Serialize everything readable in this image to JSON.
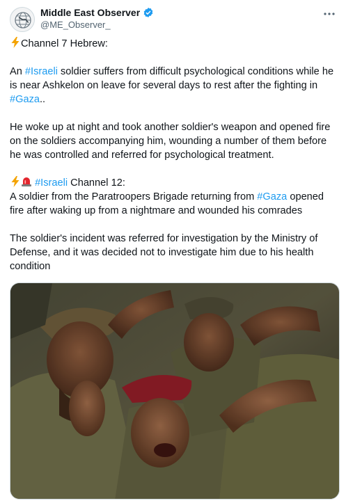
{
  "author": {
    "name": "Middle East Observer",
    "handle": "@ME_Observer_"
  },
  "icons": {
    "avatar": "globe-logo-icon",
    "verified": "verified-badge-icon",
    "more": "more-options-icon",
    "lightning": "high-voltage-emoji",
    "siren": "police-light-emoji"
  },
  "colors": {
    "hashtag": "#1d9bf0",
    "verified": "#1d9bf0",
    "muted": "#536471"
  },
  "tweet": {
    "line1_suffix": "Channel 7 Hebrew:",
    "p2_pre": "An ",
    "tag_israeli": "#Israeli",
    "p2_mid": " soldier suffers from difficult psychological conditions while he is near Ashkelon on leave for several days to rest after the fighting in ",
    "tag_gaza": "#Gaza",
    "p2_end": "..",
    "p3": "He woke up at night and took another soldier's weapon and opened fire on the soldiers accompanying him, wounding a number of them before he was controlled and referred for psychological treatment.",
    "p4_tag": "#Israeli",
    "p4_suffix": " Channel 12:",
    "p5_pre": "A soldier from the Paratroopers Brigade returning from ",
    "p5_tag": "#Gaza",
    "p5_post": " opened fire after waking up from a nightmare and wounded his comrades",
    "p6": "The soldier's incident was referred for investigation by the Ministry of Defense, and it was decided not to investigate him due to his health condition"
  }
}
